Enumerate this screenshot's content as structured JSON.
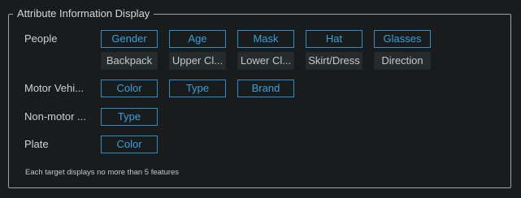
{
  "panel": {
    "title": "Attribute Information Display"
  },
  "people": {
    "label": "People",
    "row1": [
      {
        "label": "Gender",
        "selected": true
      },
      {
        "label": "Age",
        "selected": true
      },
      {
        "label": "Mask",
        "selected": true
      },
      {
        "label": "Hat",
        "selected": true
      },
      {
        "label": "Glasses",
        "selected": true
      }
    ],
    "row2": [
      {
        "label": "Backpack",
        "selected": false
      },
      {
        "label": "Upper Cl...",
        "selected": false
      },
      {
        "label": "Lower Cl...",
        "selected": false
      },
      {
        "label": "Skirt/Dress",
        "selected": false
      },
      {
        "label": "Direction",
        "selected": false
      }
    ]
  },
  "motor_vehicle": {
    "label": "Motor Vehi...",
    "options": [
      {
        "label": "Color",
        "selected": true
      },
      {
        "label": "Type",
        "selected": true
      },
      {
        "label": "Brand",
        "selected": true
      }
    ]
  },
  "non_motor": {
    "label": "Non-motor ...",
    "options": [
      {
        "label": "Type",
        "selected": true
      }
    ]
  },
  "plate": {
    "label": "Plate",
    "options": [
      {
        "label": "Color",
        "selected": true
      }
    ]
  },
  "footnote": "Each target displays no more than 5 features",
  "colors": {
    "background": "#181c1c",
    "selected_text": "#3aa0dc",
    "selected_border": "#2e8fc8",
    "unselected_fill": "#262b2b",
    "unselected_text": "#c5c8c8"
  }
}
